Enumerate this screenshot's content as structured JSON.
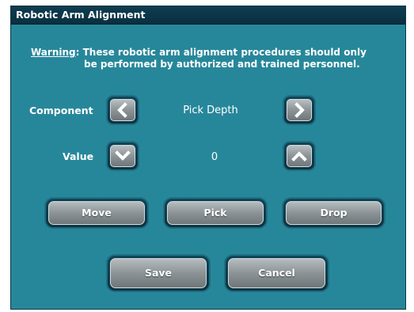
{
  "window": {
    "title": "Robotic Arm Alignment"
  },
  "warning": {
    "label": "Warning",
    "text_line1": "These robotic arm alignment procedures should only",
    "text_line2": "be performed by authorized and trained personnel."
  },
  "component": {
    "label": "Component",
    "value": "Pick Depth",
    "prev_icon": "chevron-left-icon",
    "next_icon": "chevron-right-icon"
  },
  "value_row": {
    "label": "Value",
    "value": "0",
    "down_icon": "chevron-down-icon",
    "up_icon": "chevron-up-icon"
  },
  "actions": {
    "move_label": "Move",
    "pick_label": "Pick",
    "drop_label": "Drop"
  },
  "footer": {
    "save_label": "Save",
    "cancel_label": "Cancel"
  },
  "colors": {
    "panel": "#27879a",
    "titlebar": "#0e3d51",
    "button_face": "#8f979a",
    "text": "#ffffff"
  }
}
